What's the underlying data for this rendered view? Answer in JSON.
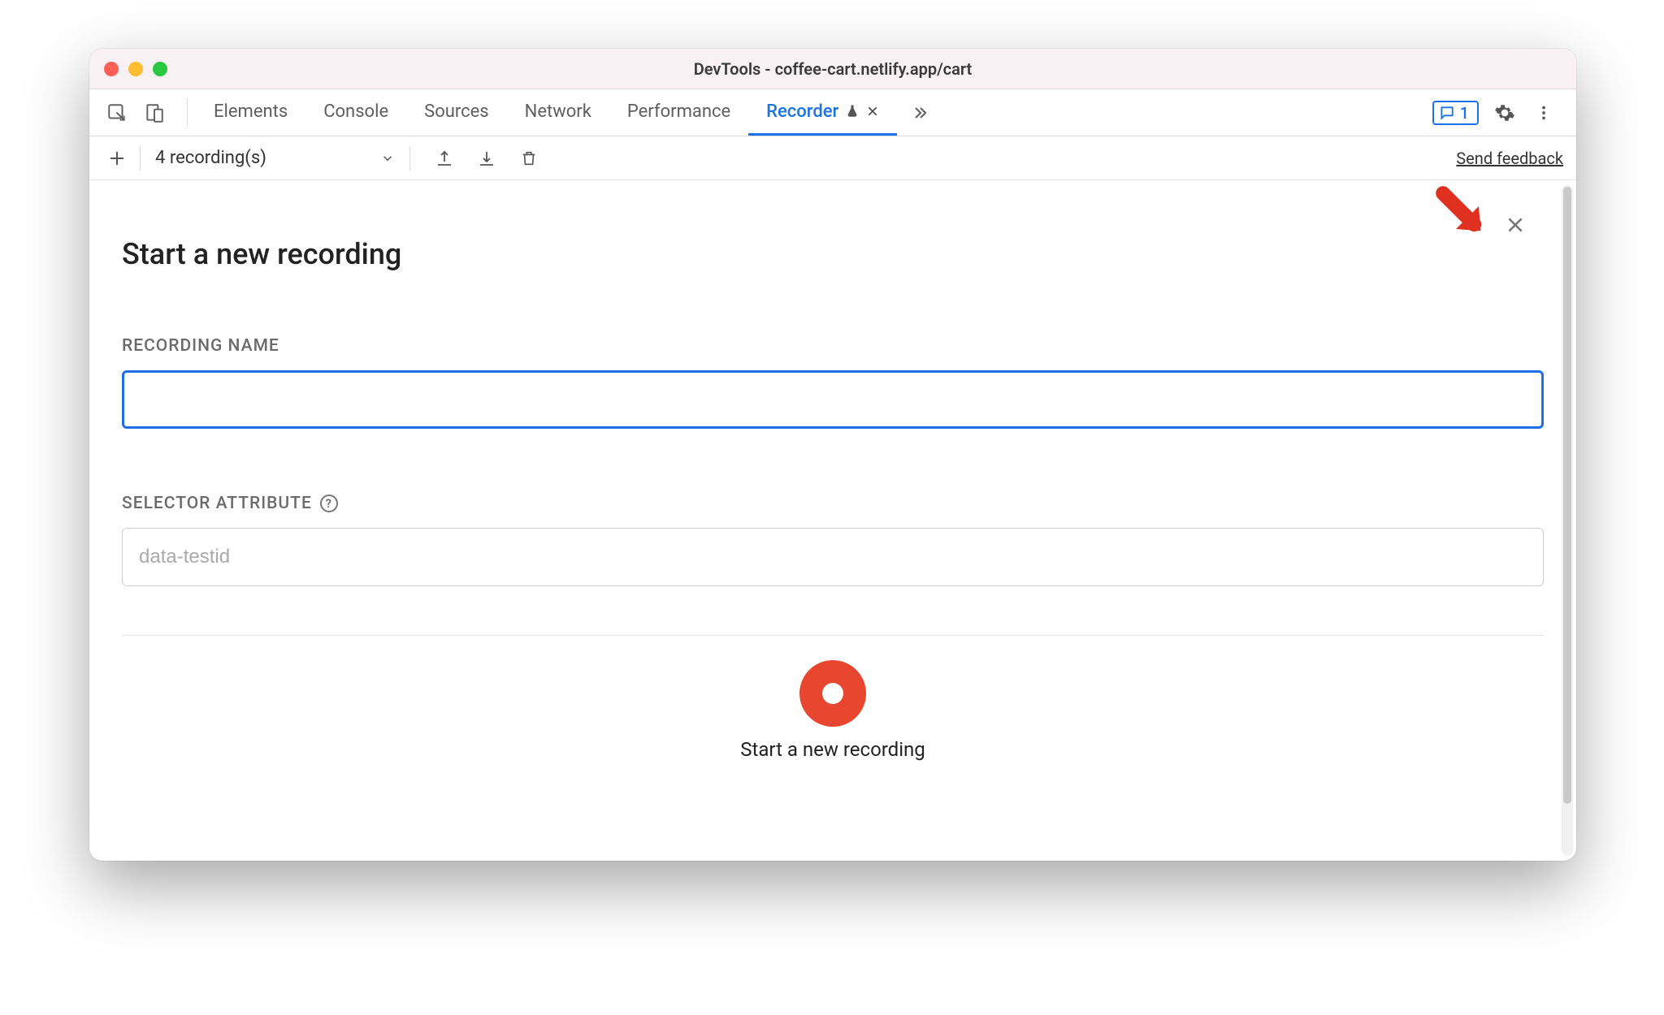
{
  "window": {
    "title": "DevTools - coffee-cart.netlify.app/cart"
  },
  "tabs": {
    "items": [
      {
        "label": "Elements"
      },
      {
        "label": "Console"
      },
      {
        "label": "Sources"
      },
      {
        "label": "Network"
      },
      {
        "label": "Performance"
      },
      {
        "label": "Recorder"
      }
    ],
    "message_count": "1"
  },
  "toolbar": {
    "recordings_label": "4 recording(s)",
    "feedback_label": "Send feedback"
  },
  "panel": {
    "heading": "Start a new recording",
    "recording_name_label": "Recording Name",
    "recording_name_value": "",
    "selector_attr_label": "Selector Attribute",
    "selector_attr_placeholder": "data-testid",
    "selector_attr_value": "",
    "record_button_label": "Start a new recording"
  }
}
